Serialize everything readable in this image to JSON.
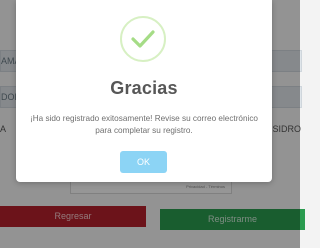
{
  "background": {
    "field_1_partial": "AMA",
    "field_2_partial": "DOR",
    "label_left_partial": "A",
    "label_right_partial": "ISIDRO",
    "captcha_footer": "Privacidad - Términos",
    "back_button": "Regresar",
    "register_button": "Registrarme"
  },
  "modal": {
    "icon": "checkmark-icon",
    "title": "Gracias",
    "message": "¡Ha sido registrado exitosamente! Revise su correo electrónico para completar su registro.",
    "ok_label": "OK"
  },
  "colors": {
    "check": "#a5dc86",
    "ok_button": "#8cd4f5",
    "back_button": "#b5202c",
    "register_button": "#2a9b4f"
  }
}
